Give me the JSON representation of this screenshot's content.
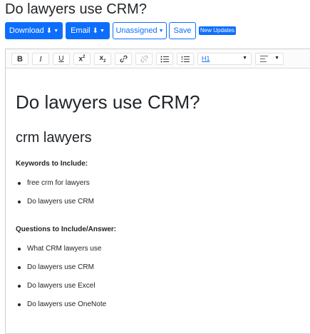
{
  "page": {
    "title": "Do lawyers use CRM?"
  },
  "toolbar": {
    "download_label": "Download",
    "email_label": "Email",
    "assign_label": "Unassigned",
    "save_label": "Save",
    "badge_label": "New Updates"
  },
  "editor": {
    "format_select": "H1",
    "tools": [
      "bold",
      "italic",
      "underline",
      "superscript",
      "subscript",
      "link",
      "unlink",
      "bullet-list",
      "numbered-list",
      "heading-select",
      "align-select"
    ],
    "glyphs": {
      "bold": "B",
      "italic": "I",
      "underline": "U",
      "superscript_base": "x",
      "superscript_exp": "2",
      "subscript_base": "x",
      "subscript_exp": "2"
    },
    "content": {
      "heading1": "Do lawyers use CRM?",
      "heading2": "crm lawyers",
      "keywords_label": "Keywords to Include:",
      "keywords": [
        "free crm for lawyers",
        "Do lawyers use CRM"
      ],
      "questions_label": "Questions to Include/Answer:",
      "questions": [
        "What CRM lawyers use",
        "Do lawyers use CRM",
        "Do lawyers use Excel",
        "Do lawyers use OneNote"
      ]
    }
  },
  "colors": {
    "primary": "#0d6efd",
    "text": "#212529",
    "border": "#cfcfcf"
  }
}
